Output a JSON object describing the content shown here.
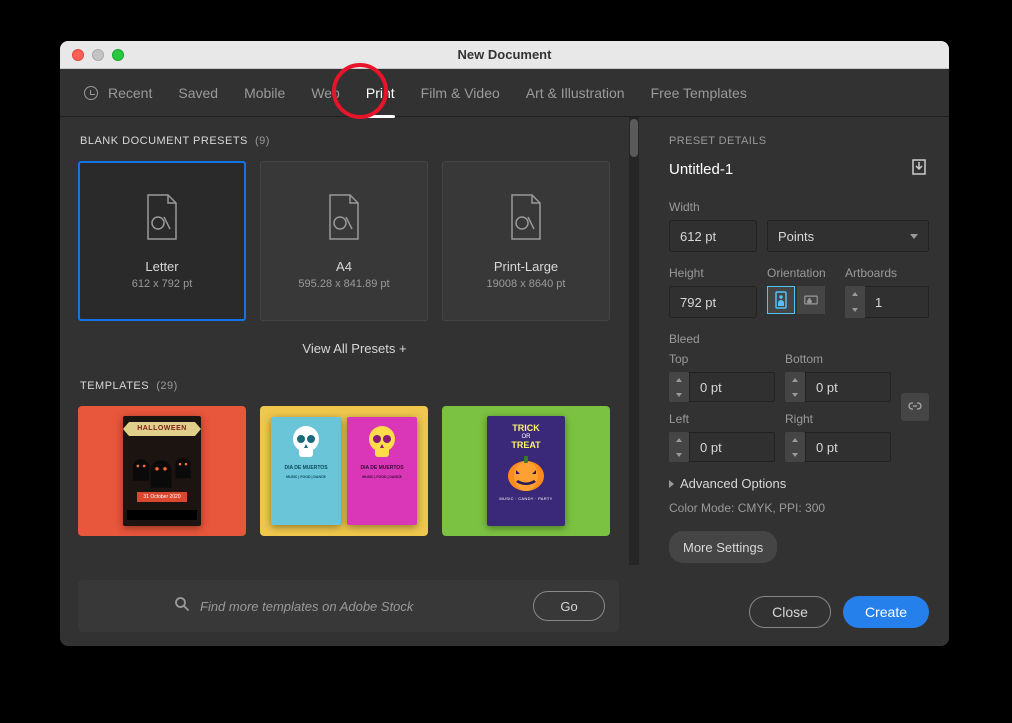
{
  "window": {
    "title": "New Document"
  },
  "tabs": {
    "recent": "Recent",
    "saved": "Saved",
    "mobile": "Mobile",
    "web": "Web",
    "print": "Print",
    "film": "Film & Video",
    "art": "Art & Illustration",
    "free": "Free Templates",
    "active": "print"
  },
  "presets_section": {
    "heading": "BLANK DOCUMENT PRESETS",
    "count": "(9)"
  },
  "presets": [
    {
      "name": "Letter",
      "dims": "612 x 792 pt",
      "selected": true
    },
    {
      "name": "A4",
      "dims": "595.28 x 841.89 pt",
      "selected": false
    },
    {
      "name": "Print-Large",
      "dims": "19008 x 8640 pt",
      "selected": false
    }
  ],
  "view_all": "View All Presets +",
  "templates_section": {
    "heading": "TEMPLATES",
    "count": "(29)"
  },
  "template_cards": {
    "halloween_banner": "HALLOWEEN",
    "halloween_date": "31 October 2020",
    "muertos_caption": "DIA DE\nMUERTOS",
    "muertos_sub": "MUSIC | FOOD | DANCE",
    "trick": "TRICK",
    "or": "OR",
    "treat": "TREAT",
    "tt_sub": "MUSIC · CANDY · PARTY"
  },
  "search": {
    "placeholder": "Find more templates on Adobe Stock",
    "go": "Go"
  },
  "details": {
    "heading": "PRESET DETAILS",
    "doc_name": "Untitled-1",
    "width_label": "Width",
    "width_value": "612 pt",
    "units": "Points",
    "height_label": "Height",
    "height_value": "792 pt",
    "orientation_label": "Orientation",
    "artboards_label": "Artboards",
    "artboards_value": "1",
    "bleed_label": "Bleed",
    "top_label": "Top",
    "bottom_label": "Bottom",
    "left_label": "Left",
    "right_label": "Right",
    "bleed_top": "0 pt",
    "bleed_bottom": "0 pt",
    "bleed_left": "0 pt",
    "bleed_right": "0 pt",
    "advanced": "Advanced Options",
    "mode_line": "Color Mode: CMYK,  PPI:  300",
    "more": "More Settings"
  },
  "buttons": {
    "close": "Close",
    "create": "Create"
  }
}
